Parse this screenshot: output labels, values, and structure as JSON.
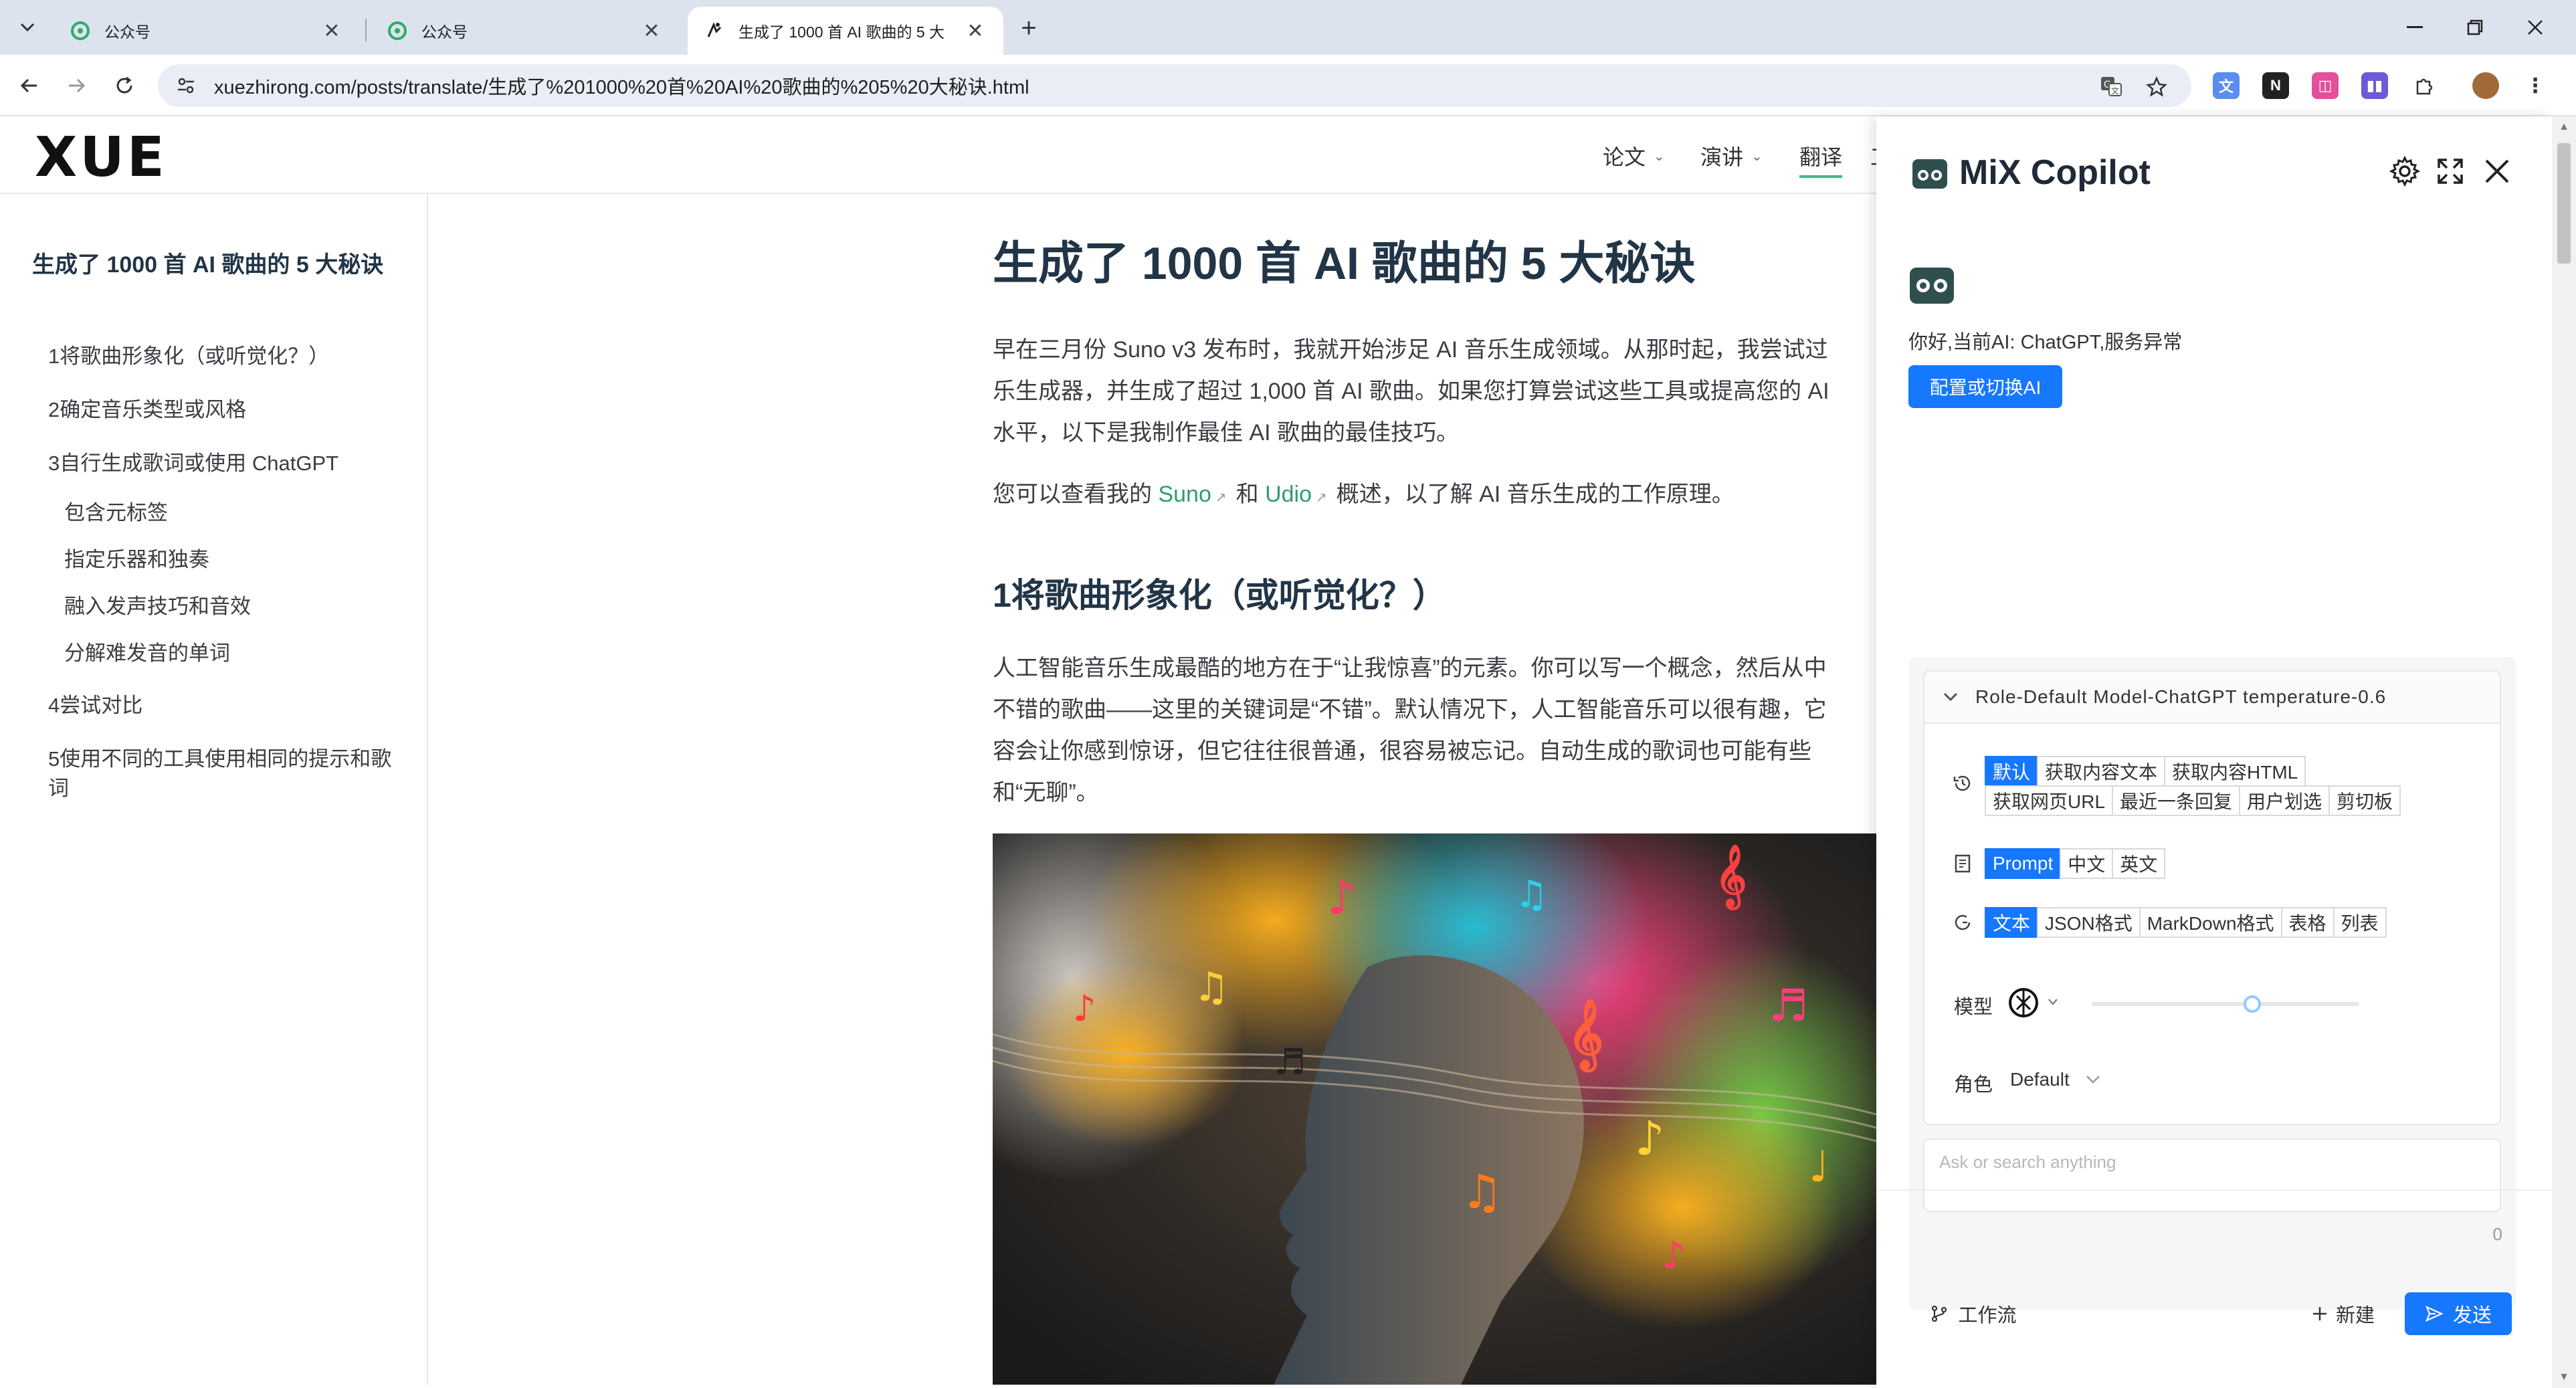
{
  "browser": {
    "tabs": [
      {
        "title": "公众号"
      },
      {
        "title": "公众号"
      },
      {
        "title": "生成了 1000 首 AI 歌曲的 5 大"
      }
    ],
    "url": "xuezhirong.com/posts/translate/生成了%201000%20首%20AI%20歌曲的%205%20大秘诀.html",
    "new_tab": "+",
    "close_glyph": "✕"
  },
  "site": {
    "logo": "XUE",
    "nav": [
      {
        "label": "论文",
        "caret": "⌄"
      },
      {
        "label": "演讲",
        "caret": "⌄"
      },
      {
        "label": "翻译",
        "caret": ""
      },
      {
        "label": "工",
        "caret": ""
      }
    ]
  },
  "sidebar": {
    "title": "生成了 1000 首 AI 歌曲的 5 大秘诀",
    "items": [
      "1将歌曲形象化（或听觉化？）",
      "2确定音乐类型或风格",
      "3自行生成歌词或使用 ChatGPT",
      "包含元标签",
      "指定乐器和独奏",
      "融入发声技巧和音效",
      "分解难发音的单词",
      "4尝试对比",
      "5使用不同的工具使用相同的提示和歌",
      "词"
    ]
  },
  "article": {
    "title": "生成了 1000 首 AI 歌曲的 5 大秘诀",
    "p1": [
      "早在三月份 Suno v3 发布时，我就开始涉足 AI 音乐生成领域。从那时起，我尝试过",
      "乐生成器，并生成了超过 1,000 首 AI 歌曲。如果您打算尝试这些工具或提高您的 AI",
      "水平，以下是我制作最佳 AI 歌曲的最佳技巧。"
    ],
    "p2_pre": "您可以查看我的 ",
    "p2_link1": "Suno",
    "p2_mid": "和 ",
    "p2_link2": "Udio",
    "p2_post": "概述，以了解 AI 音乐生成的工作原理。",
    "ext_arrow": "↗",
    "h2": "1将歌曲形象化（或听觉化？）",
    "p3": [
      "人工智能音乐生成最酷的地方在于“让我惊喜”的元素。你可以写一个概念，然后从中",
      "不错的歌曲——这里的关键词是“不错”。默认情况下，人工智能音乐可以很有趣，它",
      "容会让你感到惊讶，但它往往很普通，很容易被忘记。自动生成的歌词也可能有些",
      "和“无聊”。"
    ]
  },
  "copilot": {
    "title": "MiX Copilot",
    "greeting": "你好,当前AI: ChatGPT,服务异常",
    "config_button": "配置或切换AI",
    "panel_header": "Role-Default Model-ChatGPT temperature-0.6",
    "source_chips": [
      "默认",
      "获取内容文本",
      "获取内容HTML",
      "获取网页URL",
      "最近一条回复",
      "用户划选",
      "剪切板"
    ],
    "language_chips": [
      "Prompt",
      "中文",
      "英文"
    ],
    "format_chips": [
      "文本",
      "JSON格式",
      "MarkDown格式",
      "表格",
      "列表"
    ],
    "model_label": "模型",
    "role_label": "角色",
    "role_value": "Default",
    "temperature": 0.6,
    "input_placeholder": "Ask or search anything",
    "char_count": "0",
    "workflow_button": "工作流",
    "new_button": "新建",
    "send_button": "发送"
  },
  "colors": {
    "accent": "#1677ff",
    "link": "#2e9d6a",
    "nav_active": "#42b883"
  }
}
